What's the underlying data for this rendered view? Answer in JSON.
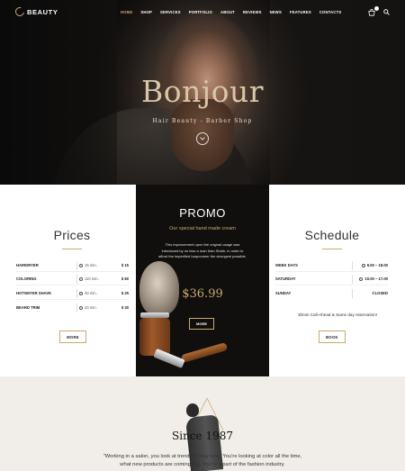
{
  "brand": {
    "name": "BEAUTY"
  },
  "nav": {
    "links": [
      "HOME",
      "SHOP",
      "SERVICES",
      "PORTFOLIO",
      "ABOUT",
      "REVIEWS",
      "NEWS",
      "FEATURES",
      "CONTACTS"
    ],
    "active": "HOME"
  },
  "hero": {
    "title": "Bonjour",
    "subtitle": "Hair Beauty - Barber Shop"
  },
  "prices": {
    "heading": "Prices",
    "rows": [
      {
        "name": "HAIRDRYER",
        "time": "15 min.",
        "price": "$ 15"
      },
      {
        "name": "COLORING",
        "time": "110 min.",
        "price": "$ 60"
      },
      {
        "name": "HOTWATER SHAVE",
        "time": "30 min.",
        "price": "$ 25"
      },
      {
        "name": "BEARD TRIM",
        "time": "40 min.",
        "price": "$ 30"
      }
    ],
    "button": "MORE"
  },
  "promo": {
    "heading": "PROMO",
    "subheading": "Our special hand made cream",
    "description": "This improvement upon the original usage was introduced by no less a man than Stubb, in order to afford the imperilled harpooneer the strongest possible.",
    "price": "$36.99",
    "button": "MORE"
  },
  "schedule": {
    "heading": "Schedule",
    "rows": [
      {
        "day": "WEEK DAYS",
        "hours": "9.00 – 18.00"
      },
      {
        "day": "SATURDAY",
        "hours": "10.00 – 17.00"
      },
      {
        "day": "SUNDAY",
        "hours": "CLOSED"
      }
    ],
    "note": "30min Call-Ahead & Same day reservation!",
    "button": "BOOK"
  },
  "since": {
    "title": "Since 1987",
    "quote": "\"Working in a salon, you look at trends all day long. You're looking at color all the time, what new products are coming out. You're a part of the fashion industry."
  },
  "colors": {
    "accent": "#c9a96e",
    "dark": "#100f0e",
    "light_bg": "#f1eee9"
  },
  "icons": [
    "logo-icon",
    "cart-icon",
    "search-icon",
    "chevron-down-icon",
    "clock-icon"
  ]
}
